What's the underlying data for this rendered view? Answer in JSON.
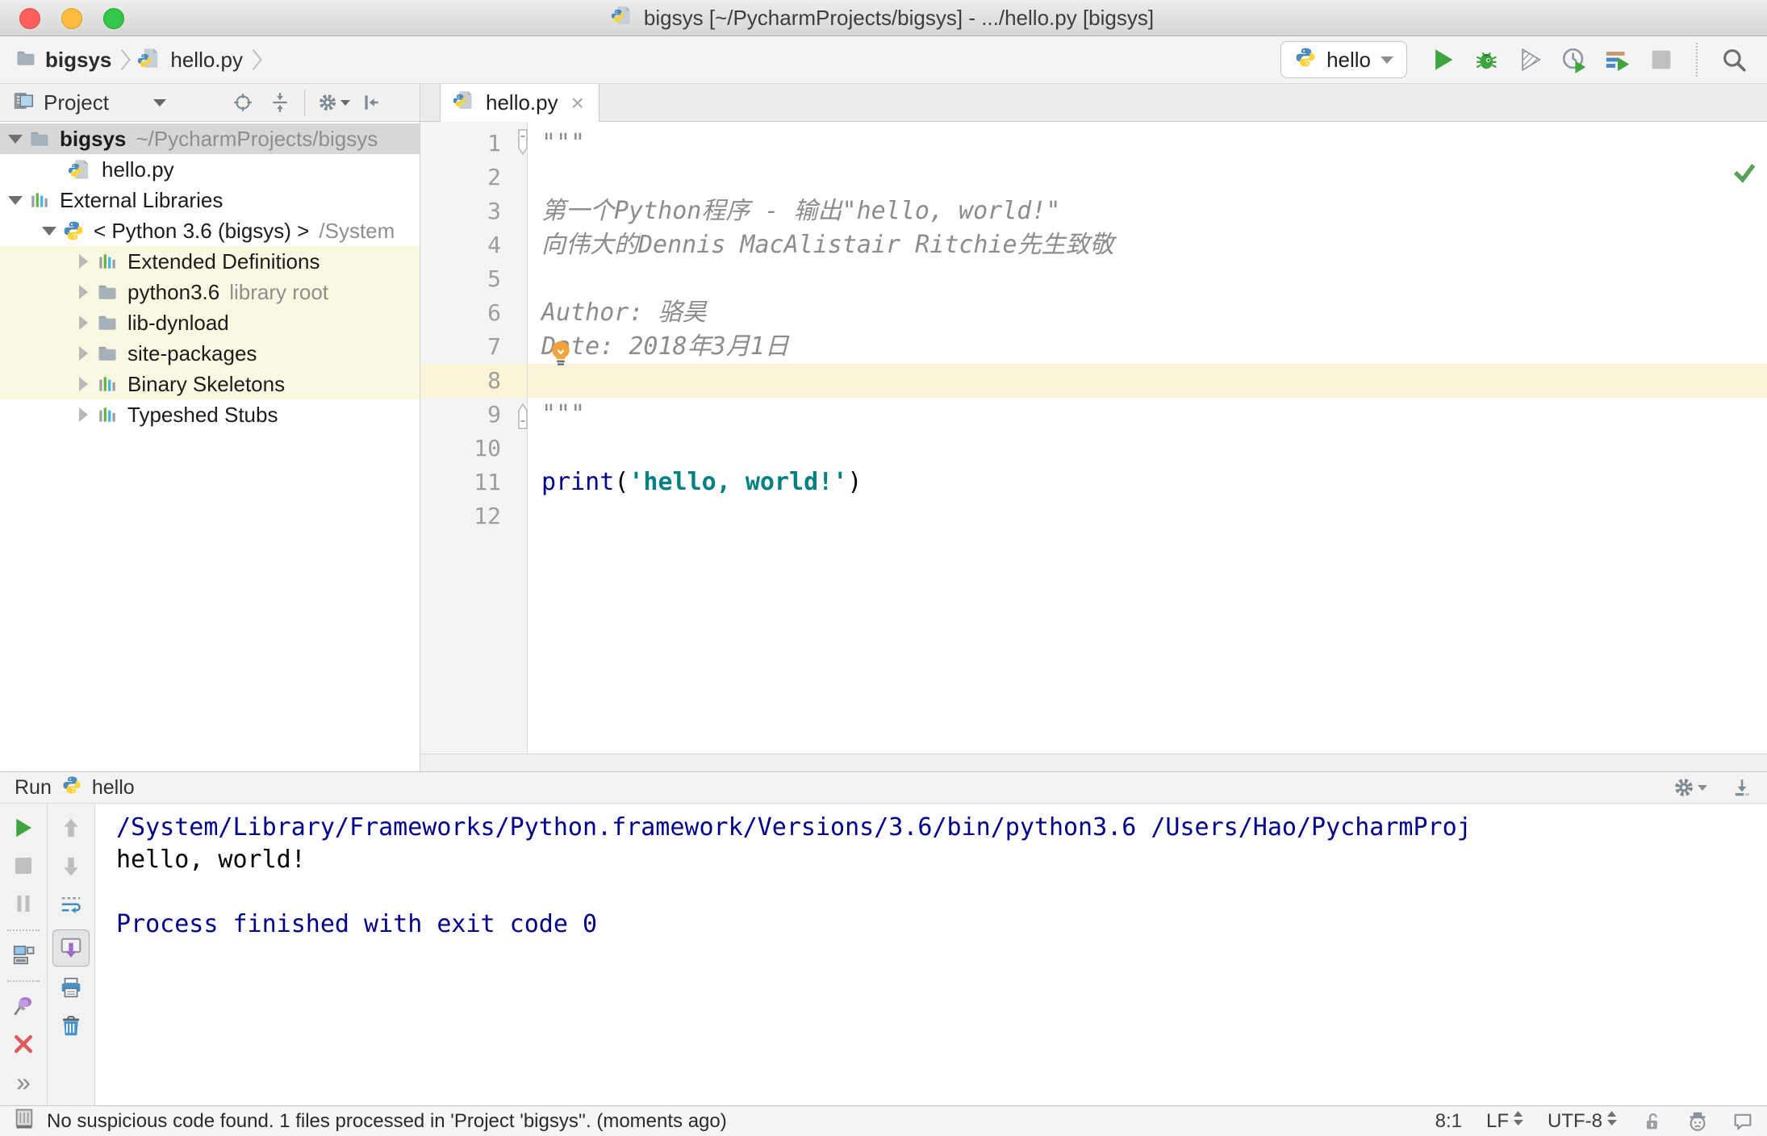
{
  "window": {
    "title": "bigsys [~/PycharmProjects/bigsys] - .../hello.py [bigsys]"
  },
  "navbar": {
    "breadcrumb": [
      {
        "icon": "folder",
        "label": "bigsys",
        "bold": true
      },
      {
        "icon": "pyfile",
        "label": "hello.py",
        "bold": false
      }
    ],
    "run_config": {
      "icon": "python",
      "label": "hello"
    },
    "actions": [
      {
        "name": "run",
        "enabled": true
      },
      {
        "name": "debug",
        "enabled": true
      },
      {
        "name": "run-with-coverage",
        "enabled": true
      },
      {
        "name": "profile",
        "enabled": true
      },
      {
        "name": "concurrency-diagram",
        "enabled": true
      },
      {
        "name": "stop",
        "enabled": false
      },
      {
        "name": "separator"
      },
      {
        "name": "search-everywhere",
        "enabled": true
      }
    ]
  },
  "project": {
    "title": "Project",
    "header_actions": [
      "locate",
      "collapse-all",
      "separator",
      "settings",
      "hide"
    ],
    "tree": [
      {
        "indent": 4,
        "arrow": "open",
        "icon": "folder",
        "label": "bigsys",
        "bold": true,
        "hint": "~/PycharmProjects/bigsys",
        "bg": "selected"
      },
      {
        "indent": 56,
        "arrow": "none",
        "icon": "pyfile",
        "label": "hello.py",
        "bold": false,
        "hint": "",
        "bg": "none"
      },
      {
        "indent": 4,
        "arrow": "open",
        "icon": "lib",
        "label": "External Libraries",
        "bold": false,
        "hint": "",
        "bg": "none"
      },
      {
        "indent": 46,
        "arrow": "open",
        "icon": "python",
        "label": "< Python 3.6 (bigsys) >",
        "bold": false,
        "hint": "/System",
        "bg": "none"
      },
      {
        "indent": 88,
        "arrow": "closed",
        "icon": "lib",
        "label": "Extended Definitions",
        "bold": false,
        "hint": "",
        "bg": "scope"
      },
      {
        "indent": 88,
        "arrow": "closed",
        "icon": "folder",
        "label": "python3.6",
        "bold": false,
        "hint": "library root",
        "bg": "scope"
      },
      {
        "indent": 88,
        "arrow": "closed",
        "icon": "folder",
        "label": "lib-dynload",
        "bold": false,
        "hint": "",
        "bg": "scope"
      },
      {
        "indent": 88,
        "arrow": "closed",
        "icon": "folder",
        "label": "site-packages",
        "bold": false,
        "hint": "",
        "bg": "scope"
      },
      {
        "indent": 88,
        "arrow": "closed",
        "icon": "lib",
        "label": "Binary Skeletons",
        "bold": false,
        "hint": "",
        "bg": "scope"
      },
      {
        "indent": 88,
        "arrow": "closed",
        "icon": "lib",
        "label": "Typeshed Stubs",
        "bold": false,
        "hint": "",
        "bg": "none"
      }
    ]
  },
  "editor": {
    "tab": {
      "icon": "pyfile",
      "label": "hello.py"
    },
    "lines": [
      {
        "n": "1",
        "fold": "start",
        "segs": [
          {
            "t": "\"\"\"",
            "c": "doc"
          }
        ]
      },
      {
        "n": "2",
        "segs": []
      },
      {
        "n": "3",
        "segs": [
          {
            "t": "第一个Python程序 - 输出\"hello, world!\"",
            "c": "doc"
          }
        ]
      },
      {
        "n": "4",
        "segs": [
          {
            "t": "向伟大的Dennis MacAlistair Ritchie先生致敬",
            "c": "doc"
          }
        ]
      },
      {
        "n": "5",
        "segs": []
      },
      {
        "n": "6",
        "segs": [
          {
            "t": "Author: 骆昊",
            "c": "doc"
          }
        ]
      },
      {
        "n": "7",
        "bulb": true,
        "segs": [
          {
            "t": "Date: 2018年3月1日",
            "c": "doc"
          }
        ]
      },
      {
        "n": "8",
        "caret": true,
        "segs": []
      },
      {
        "n": "9",
        "fold": "end",
        "segs": [
          {
            "t": "\"\"\"",
            "c": "doc"
          }
        ]
      },
      {
        "n": "10",
        "segs": []
      },
      {
        "n": "11",
        "segs": [
          {
            "t": "print",
            "c": "kw"
          },
          {
            "t": "(",
            "c": "plain"
          },
          {
            "t": "'hello, world!'",
            "c": "str"
          },
          {
            "t": ")",
            "c": "plain"
          }
        ]
      },
      {
        "n": "12",
        "segs": []
      }
    ]
  },
  "run_panel": {
    "title": "Run",
    "config": {
      "icon": "python",
      "label": "hello"
    },
    "header_actions": [
      "settings",
      "minimize"
    ],
    "toolbar_main": [
      {
        "name": "rerun",
        "enabled": true
      },
      {
        "name": "stop",
        "enabled": false
      },
      {
        "name": "pause-output",
        "enabled": false
      },
      {
        "name": "separator"
      },
      {
        "name": "restore-layout",
        "enabled": true
      },
      {
        "name": "separator"
      },
      {
        "name": "pin-tab",
        "enabled": true
      },
      {
        "name": "close",
        "enabled": true
      },
      {
        "name": "more",
        "enabled": true
      }
    ],
    "toolbar_console": [
      {
        "name": "up-stack-trace",
        "enabled": false
      },
      {
        "name": "down-stack-trace",
        "enabled": false
      },
      {
        "name": "soft-wrap",
        "enabled": true
      },
      {
        "name": "scroll-to-end",
        "enabled": true,
        "selected": true
      },
      {
        "name": "print",
        "enabled": true
      },
      {
        "name": "clear-all",
        "enabled": true
      }
    ],
    "console": [
      {
        "text": "/System/Library/Frameworks/Python.framework/Versions/3.6/bin/python3.6 /Users/Hao/PycharmProj",
        "style": "system"
      },
      {
        "text": "hello, world!",
        "style": "stdout"
      },
      {
        "text": "",
        "style": "stdout"
      },
      {
        "text": "Process finished with exit code 0",
        "style": "system"
      }
    ]
  },
  "status_bar": {
    "message": "No suspicious code found. 1 files processed in 'Project 'bigsys''. (moments ago)",
    "caret_position": "8:1",
    "line_separator": "LF",
    "encoding": "UTF-8",
    "right_icons": [
      "unlock",
      "inspections-profile",
      "event-log"
    ]
  },
  "colors": {
    "keyword": "#00008B",
    "string": "#008080",
    "doc_comment": "#8C8C8C",
    "console_system": "#00008B",
    "tree_selection_bg": "#D7D7D7",
    "library_scope_bg": "#FBF8E1",
    "caret_line_bg": "#FBF5D8"
  }
}
